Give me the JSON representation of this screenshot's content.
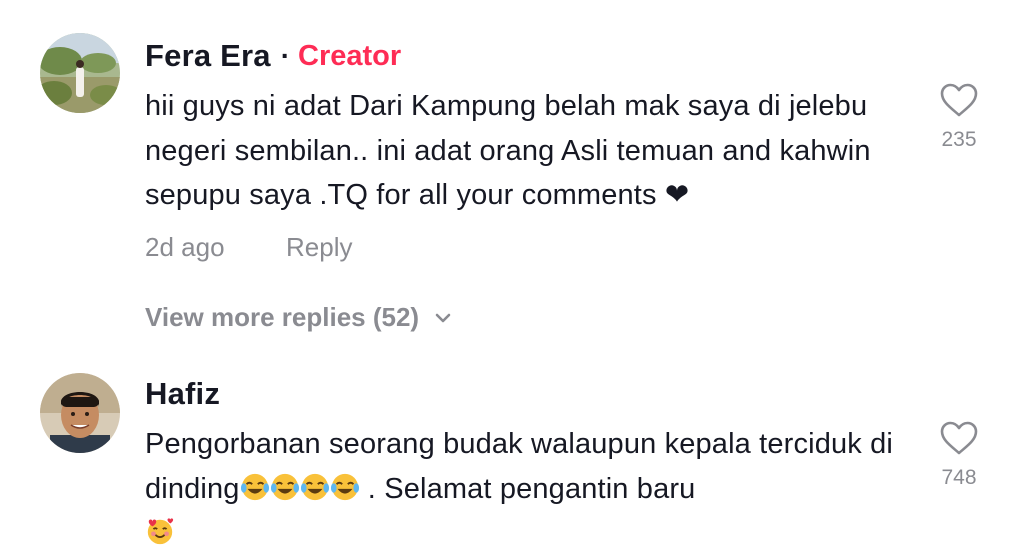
{
  "comments": [
    {
      "author": "Fera Era",
      "separator": "·",
      "badge": "Creator",
      "text": "hii guys ni adat Dari Kampung belah mak saya di jelebu negeri sembilan.. ini adat orang Asli temuan and kahwin sepupu saya .TQ for all your comments ❤",
      "time": "2d ago",
      "reply_label": "Reply",
      "likes": "235",
      "view_more": "View more replies (52)"
    },
    {
      "author": "Hafiz",
      "text_part1": "Pengorbanan seorang budak walaupun kepala terciduk di dinding",
      "text_part2": " . Selamat pengantin baru",
      "likes": "748"
    }
  ],
  "colors": {
    "creator_badge": "#fe2c55",
    "primary_text": "#161823",
    "secondary_text": "#8a8b91"
  },
  "icons": {
    "like": "heart-outline-icon",
    "expand": "chevron-down-icon",
    "emoji_laugh": "tears-of-joy-emoji",
    "emoji_love": "smiling-face-with-hearts-emoji"
  }
}
